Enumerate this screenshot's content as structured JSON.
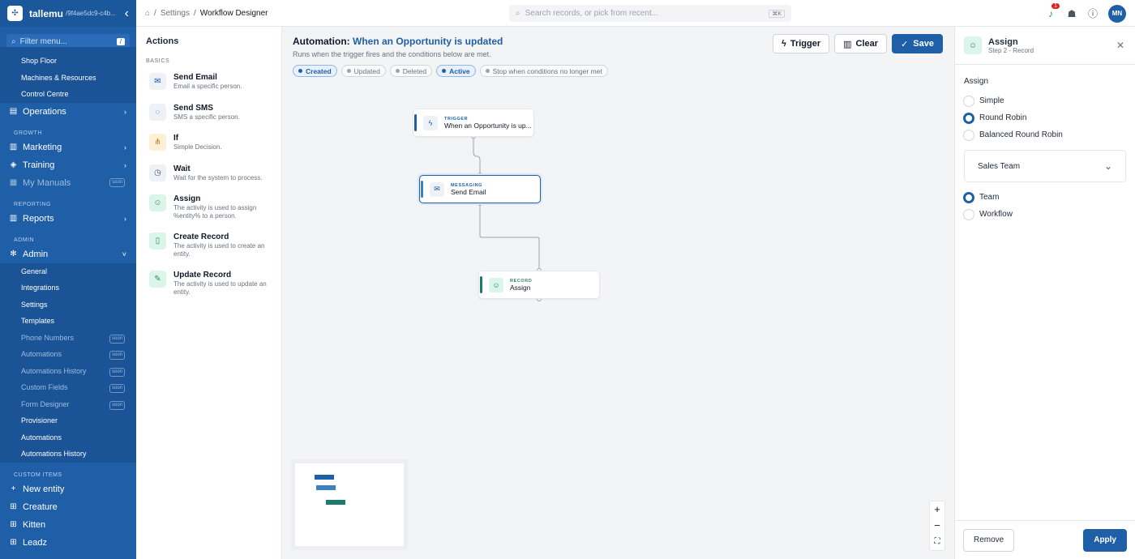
{
  "brand": {
    "name": "tallemu",
    "id": "/9f4ae5dc9-c4b..."
  },
  "sidebar": {
    "filter_placeholder": "Filter menu...",
    "filter_key": "/",
    "items_top": [
      "Shop Floor",
      "Machines & Resources",
      "Control Centre"
    ],
    "operations": "Operations",
    "growth": "GROWTH",
    "marketing": "Marketing",
    "training": "Training",
    "manuals": "My Manuals",
    "soon": "soon",
    "reporting": "REPORTING",
    "reports": "Reports",
    "admin_sec": "ADMIN",
    "admin": "Admin",
    "admin_items": [
      "General",
      "Integrations",
      "Settings",
      "Templates",
      "Phone Numbers",
      "Automations",
      "Automations History",
      "Custom Fields",
      "Form Designer",
      "Provisioner",
      "Automations",
      "Automations History"
    ],
    "custom_sec": "CUSTOM ITEMS",
    "new_entity": "New entity",
    "custom_items": [
      "Creature",
      "Kitten",
      "Leadz"
    ]
  },
  "topbar": {
    "crumb1": "Settings",
    "crumb2": "Workflow Designer",
    "search_placeholder": "Search records, or pick from recent...",
    "search_key": "⌘K",
    "notif_count": "1",
    "avatar": "MN"
  },
  "actions": {
    "title": "Actions",
    "section": "BASICS",
    "items": [
      {
        "name": "Send Email",
        "desc": "Email a specific person."
      },
      {
        "name": "Send SMS",
        "desc": "SMS a specific person."
      },
      {
        "name": "If",
        "desc": "Simple Decision."
      },
      {
        "name": "Wait",
        "desc": "Wait for the system to process."
      },
      {
        "name": "Assign",
        "desc": "The activity is used to assign %entity% to a person."
      },
      {
        "name": "Create Record",
        "desc": "The activity is used to create an entity."
      },
      {
        "name": "Update Record",
        "desc": "The activity is used to update an entity."
      }
    ]
  },
  "canvas": {
    "title_prefix": "Automation:",
    "title": "When an Opportunity is updated",
    "subtitle": "Runs when the trigger fires and the conditions below are met.",
    "chips": [
      "Created",
      "Updated",
      "Deleted",
      "Active",
      "Stop when conditions no longer met"
    ],
    "trigger_btn": "Trigger",
    "clear_btn": "Clear",
    "save_btn": "Save",
    "nodes": [
      {
        "kind": "TRIGGER",
        "name": "When an Opportunity is up..."
      },
      {
        "kind": "MESSAGING",
        "name": "Send Email"
      },
      {
        "kind": "RECORD",
        "name": "Assign"
      }
    ],
    "zoom_in": "+",
    "zoom_out": "−",
    "fit": "⛶"
  },
  "panel": {
    "title": "Assign",
    "step": "Step 2 - Record",
    "label": "Assign",
    "modes": [
      "Simple",
      "Round Robin",
      "Balanced Round Robin"
    ],
    "selected_mode": "Round Robin",
    "select_value": "Sales Team",
    "targets": [
      "Team",
      "Workflow"
    ],
    "selected_target": "Team",
    "remove": "Remove",
    "apply": "Apply"
  },
  "colors": {
    "brand": "#1e5fa8",
    "trigger_bar": "#1e5fa8",
    "messaging_bar": "#3b82c4",
    "record_bar": "#1f7a6e"
  }
}
